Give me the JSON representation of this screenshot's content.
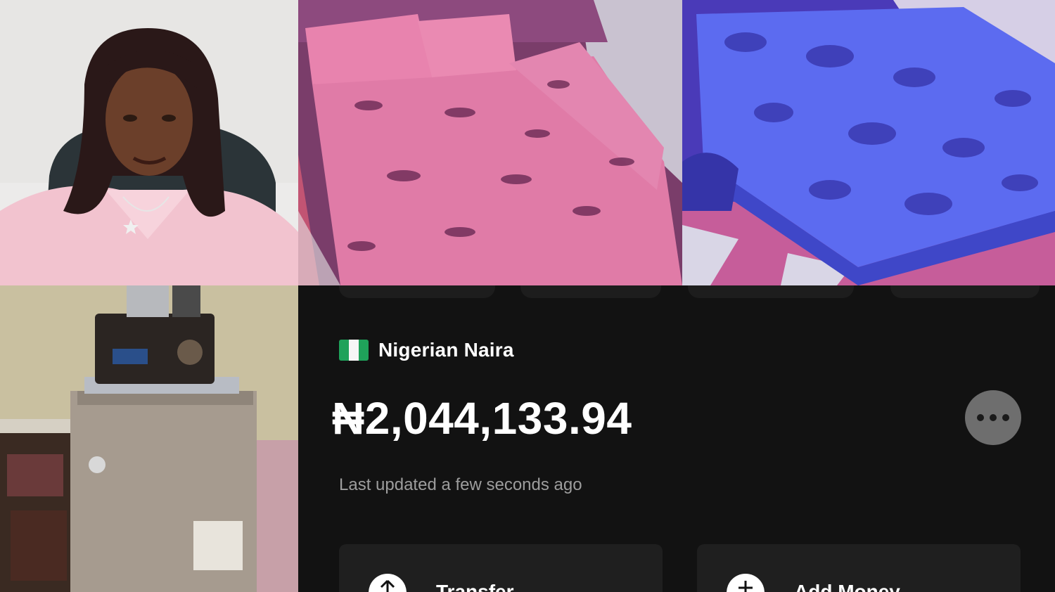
{
  "photos": {
    "portrait": "portrait-photo",
    "bed_pink": "pink-bed-photo",
    "bed_blue": "blue-bed-photo",
    "appliance": "blender-and-fridge-photo"
  },
  "wallet": {
    "flag_icon": "nigeria-flag-icon",
    "currency_name": "Nigerian Naira",
    "balance": "₦2,044,133.94",
    "more_icon": "more-dots-icon",
    "last_updated": "Last updated a few seconds ago",
    "actions": [
      {
        "label": "Transfer",
        "icon": "arrow-up-icon"
      },
      {
        "label": "Add Money",
        "icon": "plus-icon"
      }
    ]
  },
  "colors": {
    "background": "#121212",
    "card": "#1f1f1f",
    "flag_green": "#1fa25a",
    "more_button": "#6e6e6e",
    "muted_text": "#9d9d9d"
  }
}
